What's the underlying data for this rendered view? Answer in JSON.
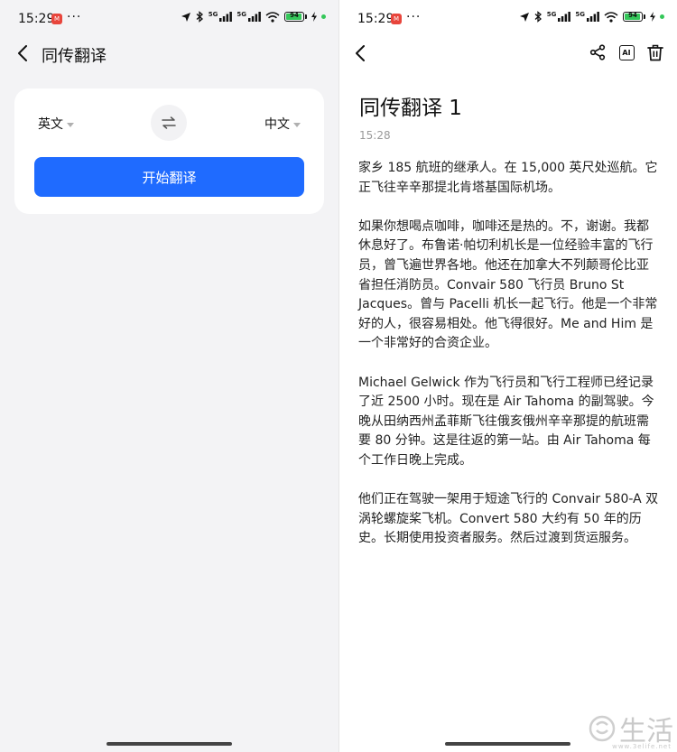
{
  "status_bar": {
    "time": "15:29",
    "notif_badge": "M",
    "more": "···",
    "network_1": "5G",
    "network_2": "5G",
    "battery": "94"
  },
  "left_screen": {
    "title": "同传翻译",
    "source_lang": "英文",
    "target_lang": "中文",
    "start_button": "开始翻译"
  },
  "right_screen": {
    "title": "同传翻译 1",
    "time": "15:28",
    "paragraphs": [
      "家乡 185 航班的继承人。在 15,000 英尺处巡航。它正飞往辛辛那提北肯塔基国际机场。",
      "如果你想喝点咖啡，咖啡还是热的。不，谢谢。我都休息好了。布鲁诺·帕切利机长是一位经验丰富的飞行员，曾飞遍世界各地。他还在加拿大不列颠哥伦比亚省担任消防员。Convair 580 飞行员 Bruno St Jacques。曾与 Pacelli 机长一起飞行。他是一个非常好的人，很容易相处。他飞得很好。Me and Him 是一个非常好的合资企业。",
      "Michael Gelwick 作为飞行员和飞行工程师已经记录了近 2500 小时。现在是 Air Tahoma 的副驾驶。今晚从田纳西州孟菲斯飞往俄亥俄州辛辛那提的航班需要 80 分钟。这是往返的第一站。由 Air Tahoma 每个工作日晚上完成。",
      "他们正在驾驶一架用于短途飞行的 Convair 580-A 双涡轮螺旋桨飞机。Convert 580 大约有 50 年的历史。长期使用投资者服务。然后过渡到货运服务。"
    ]
  },
  "watermark": {
    "text": "生活",
    "url": "www.3elife.net"
  },
  "icons": {
    "back": "chevron-left-icon",
    "swap": "swap-arrows-icon",
    "share": "share-icon",
    "ai": "ai-icon",
    "delete": "trash-icon"
  },
  "colors": {
    "accent": "#1f6bff",
    "left_background": "#f3f3f5",
    "battery": "#34c759"
  }
}
